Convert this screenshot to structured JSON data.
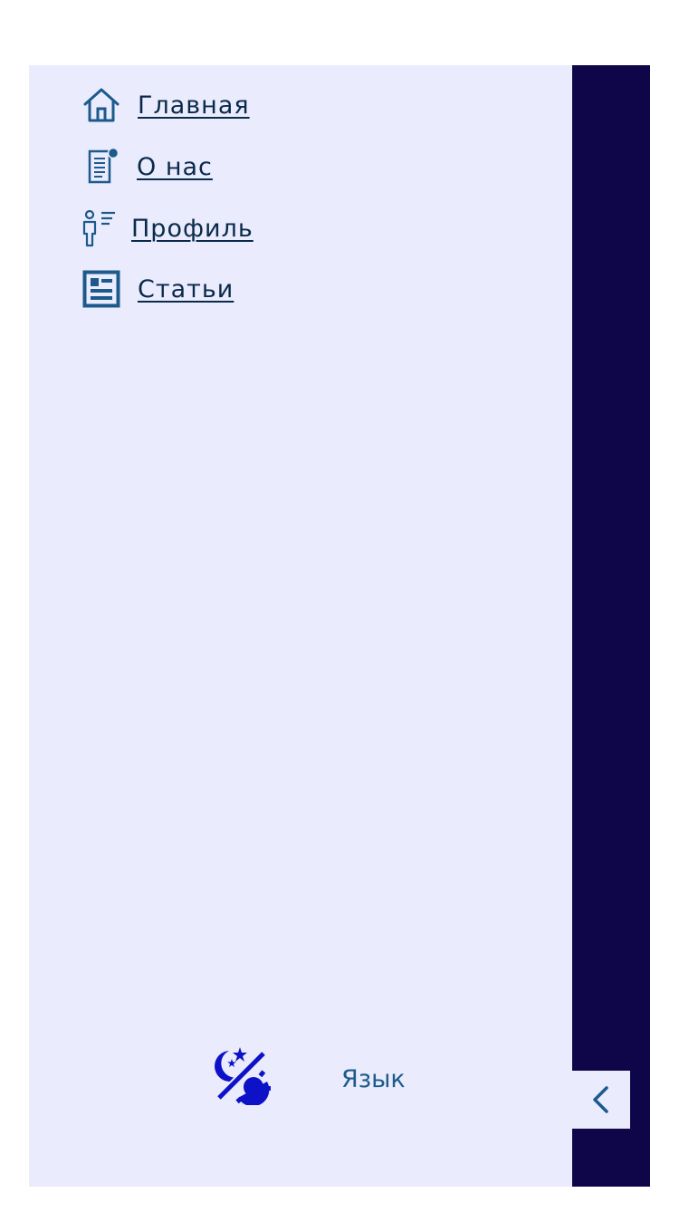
{
  "sidebar": {
    "nav": [
      {
        "label": "Главная",
        "icon": "home-icon"
      },
      {
        "label": "О нас",
        "icon": "document-notification-icon"
      },
      {
        "label": "Профиль",
        "icon": "user-list-icon"
      },
      {
        "label": "Статьи",
        "icon": "newspaper-icon"
      }
    ],
    "theme_toggle_icon": "theme-toggle-icon",
    "language_label": "Язык",
    "collapse_icon": "chevron-left-icon"
  },
  "colors": {
    "sidebar_bg": "#eaebfc",
    "dark_strip": "#0e0648",
    "icon_blue": "#1c5a8c",
    "theme_icon_blue": "#0d12c8",
    "link_text": "#0a2a4a"
  }
}
